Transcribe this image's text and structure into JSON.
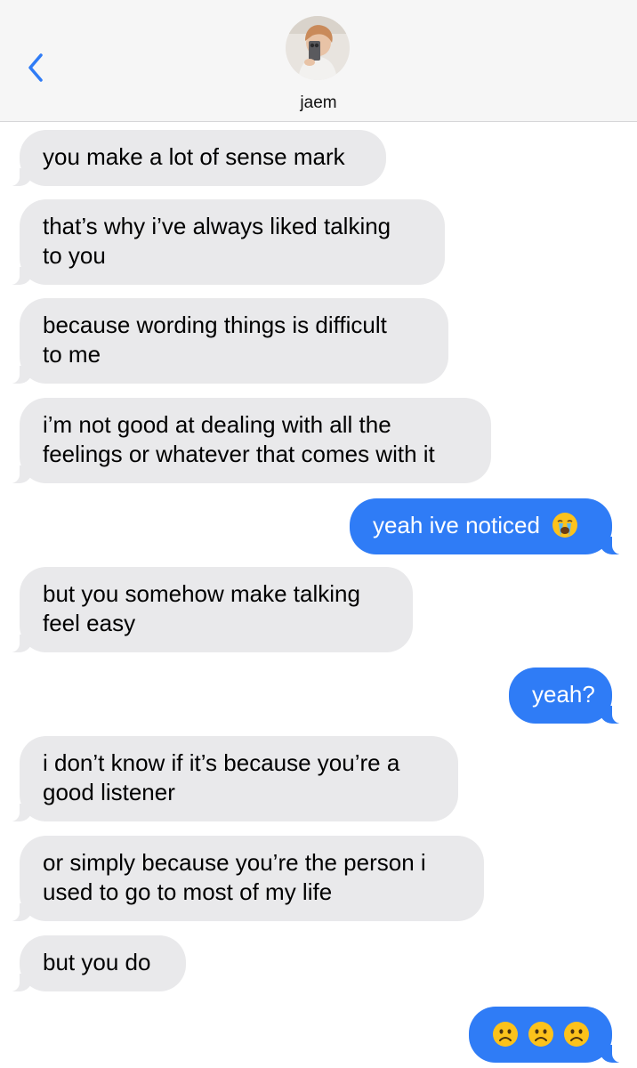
{
  "header": {
    "contact_name": "jaem"
  },
  "messages": [
    {
      "side": "in",
      "lines": [
        "you make a lot of sense mark"
      ]
    },
    {
      "side": "in",
      "lines": [
        "that’s why i’ve always liked talking",
        "to you"
      ]
    },
    {
      "side": "in",
      "lines": [
        "because wording things is difficult",
        "to me"
      ]
    },
    {
      "side": "in",
      "lines": [
        "i’m not good at dealing with all the",
        "feelings or whatever that comes with it"
      ]
    },
    {
      "side": "out",
      "text": "yeah ive noticed",
      "emoji": "loudly-crying-face"
    },
    {
      "side": "in",
      "lines": [
        "but you somehow make talking",
        "feel easy"
      ]
    },
    {
      "side": "out",
      "text": "yeah?"
    },
    {
      "side": "in",
      "lines": [
        "i don’t know if it’s because you’re a",
        "good listener"
      ]
    },
    {
      "side": "in",
      "lines": [
        "or simply because you’re the person i",
        "used to go to most of my life"
      ]
    },
    {
      "side": "in",
      "lines": [
        "but you do"
      ]
    },
    {
      "side": "out",
      "emojis": [
        "frowning-face",
        "frowning-face",
        "frowning-face"
      ]
    }
  ],
  "colors": {
    "incoming_bubble": "#e9e9eb",
    "outgoing_bubble": "#2f7cf6",
    "accent": "#2f7cf6",
    "emoji_yellow": "#fcc21b"
  }
}
